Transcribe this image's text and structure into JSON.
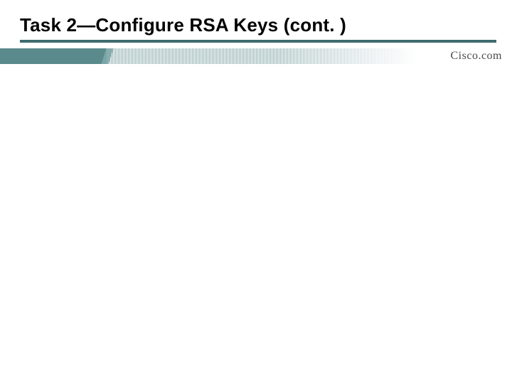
{
  "slide": {
    "title": "Task 2—Configure RSA Keys (cont. )",
    "brand": "Cisco.com"
  }
}
